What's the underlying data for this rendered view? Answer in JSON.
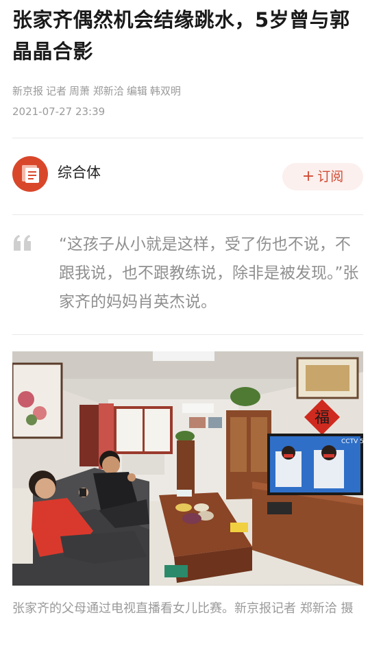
{
  "article": {
    "title": "张家齐偶然机会结缘跳水，5岁曾与郭晶晶合影",
    "outlet": "新京报",
    "reporter_label": "记者",
    "reporters": "周萧 郑新洽",
    "editor_label": "编辑",
    "editor": "韩双明",
    "date": "2021-07-27 23:39"
  },
  "source": {
    "name": "综合体",
    "subscribe_label": "订阅",
    "subscribe_icon": "plus-icon"
  },
  "quote": {
    "icon": "quote-icon",
    "text": "“这孩子从小就是这样，受了伤也不说，不跟我说，也不跟教练说，除非是被发现。”张家齐的妈妈肖英杰说。"
  },
  "photo": {
    "tv_text": "CCTV 5"
  },
  "caption": "张家齐的父母通过电视直播看女儿比赛。新京报记者 郑新洽 摄",
  "colors": {
    "accent": "#d04a33",
    "avatar": "#d9472b",
    "meta_text": "#9a9a9a",
    "quote_text": "#8f8f8f"
  }
}
